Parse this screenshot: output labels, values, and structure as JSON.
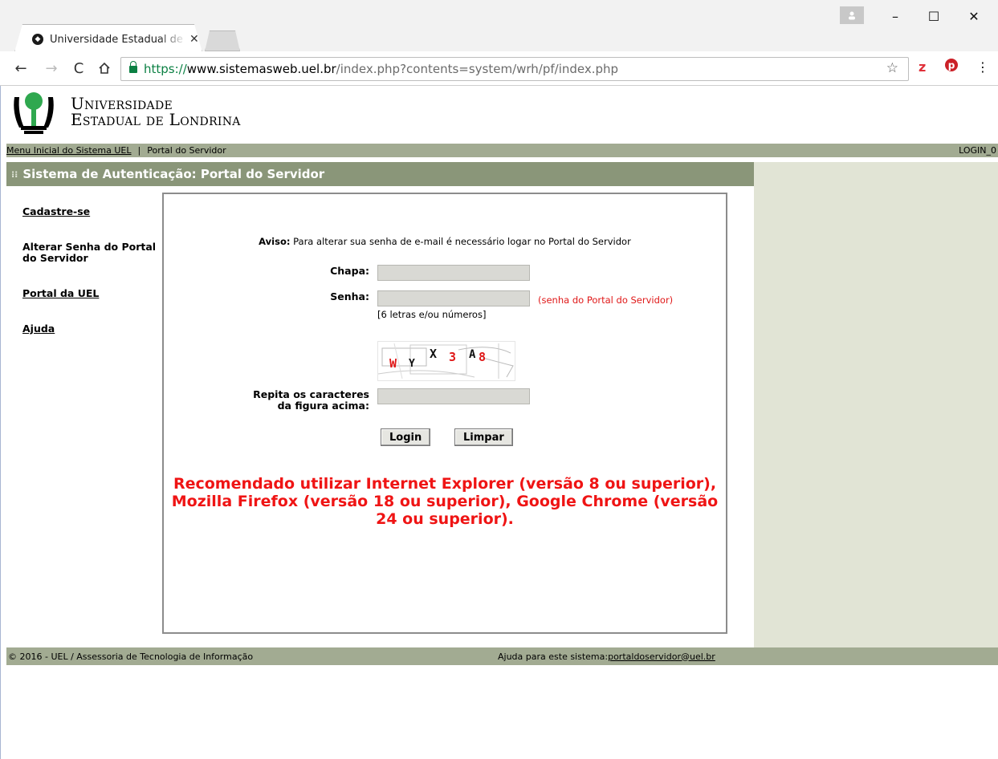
{
  "browser": {
    "tab_title": "Universidade Estadual de Londrina",
    "tab_close": "✕",
    "url_scheme": "https://",
    "url_host": "www.sistemasweb.uel.br",
    "url_path": "/index.php?contents=system/wrh/pf/index.php",
    "window_controls": {
      "minimize": "–",
      "maximize": "☐",
      "close": "✕"
    },
    "extensions": [
      "z",
      "p"
    ],
    "menu": "⋮"
  },
  "header": {
    "logo_line1": "Universidade",
    "logo_line2": "Estadual de Londrina"
  },
  "navbar": {
    "menu_link": "Menu Inicial do Sistema UEL",
    "separator": "|",
    "current": "Portal do Servidor",
    "login_code": "LOGIN_0"
  },
  "title": "Sistema de Autenticação: Portal do Servidor",
  "sidebar": {
    "items": [
      {
        "label": "Cadastre-se",
        "link": true
      },
      {
        "label": "Alterar Senha do Portal do Servidor",
        "link": false
      },
      {
        "label": "Portal da UEL",
        "link": true
      },
      {
        "label": "Ajuda",
        "link": true
      }
    ]
  },
  "form": {
    "notice_bold": "Aviso:",
    "notice_text": " Para alterar sua senha de e-mail é necessário logar no Portal do Servidor",
    "chapa_label": "Chapa:",
    "chapa_value": "",
    "senha_label": "Senha:",
    "senha_value": "",
    "senha_hint": "(senha do Portal do Servidor)",
    "senha_rule": "[6 letras e/ou números]",
    "captcha_chars": [
      "W",
      "Y",
      "X",
      "3",
      "A",
      "8"
    ],
    "captcha_label_1": "Repita os caracteres",
    "captcha_label_2": "da figura acima:",
    "captcha_value": "",
    "login_button": "Login",
    "clear_button": "Limpar",
    "recommendation": "Recomendado utilizar Internet Explorer (versão 8 ou superior), Mozilla Firefox (versão 18 ou superior), Google Chrome (versão 24 ou superior)."
  },
  "footer": {
    "copyright": "© 2016 - UEL / Assessoria de Tecnologia de Informação",
    "help_label": "Ajuda para este sistema:",
    "help_email": "portaldoservidor@uel.br"
  },
  "colors": {
    "nav_bar": "#a2ab92",
    "title_bar": "#8a9679",
    "right_panel": "#e1e4d5",
    "warning_red": "#ef1414"
  }
}
